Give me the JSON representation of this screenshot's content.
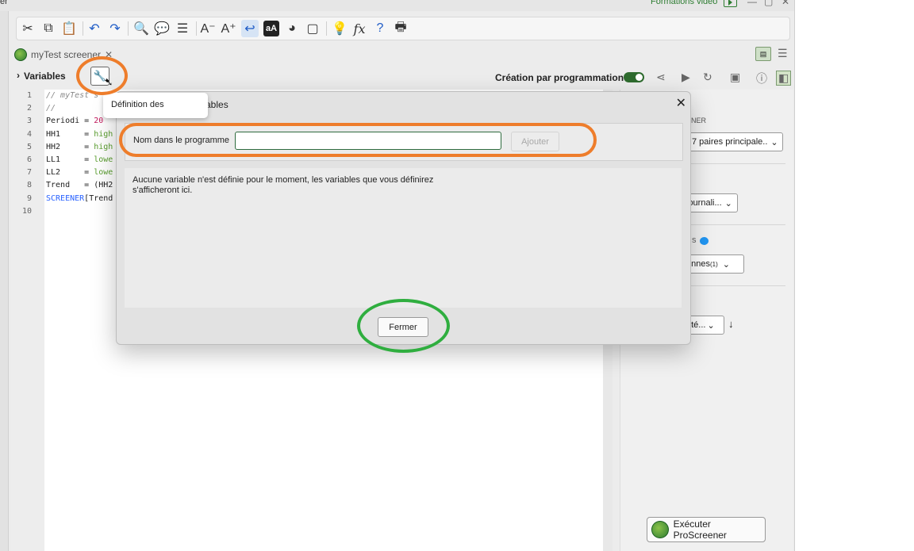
{
  "window": {
    "title_fragment": "er",
    "promo_link": "Formations vidéo"
  },
  "toolbar": {
    "icons": [
      "cut-icon",
      "copy-icon",
      "paste-icon",
      "undo-icon",
      "redo-icon",
      "search-icon",
      "comment-icon",
      "indent-icon",
      "decrease-font-icon",
      "increase-font-icon",
      "wrap-icon",
      "font-case-icon",
      "color-wheel-icon",
      "frame-icon",
      "bulb-icon",
      "function-icon",
      "help-icon",
      "print-icon"
    ]
  },
  "tab": {
    "label": "myTest screener",
    "close": "✕"
  },
  "varbar": {
    "label": "Variables",
    "creation_label": "Création par programmation"
  },
  "tooltip": {
    "text": "Définition des"
  },
  "editor": {
    "line_numbers": [
      "1",
      "2",
      "3",
      "4",
      "5",
      "6",
      "7",
      "8",
      "9",
      "10"
    ],
    "lines": [
      [
        {
          "t": "// myTest s",
          "c": "c-com"
        }
      ],
      [
        {
          "t": "//",
          "c": "c-com"
        }
      ],
      [
        {
          "t": "Periodi = ",
          "c": ""
        },
        {
          "t": "20",
          "c": "c-num"
        }
      ],
      [
        {
          "t": "HH1     = ",
          "c": ""
        },
        {
          "t": "high",
          "c": "c-grn"
        }
      ],
      [
        {
          "t": "HH2     = ",
          "c": ""
        },
        {
          "t": "high",
          "c": "c-grn"
        }
      ],
      [
        {
          "t": "LL1     = ",
          "c": ""
        },
        {
          "t": "lowe",
          "c": "c-grn"
        }
      ],
      [
        {
          "t": "LL2     = ",
          "c": ""
        },
        {
          "t": "lowe",
          "c": "c-grn"
        }
      ],
      [
        {
          "t": "Trend   = (HH2",
          "c": ""
        }
      ],
      [
        {
          "t": "SCREENER",
          "c": "c-blu"
        },
        {
          "t": "[Trend",
          "c": ""
        }
      ],
      []
    ]
  },
  "dialog": {
    "title_fragment": "ables",
    "close": "✕",
    "name_label": "Nom dans le programme",
    "name_value": "",
    "add_button": "Ajouter",
    "info_text": "Aucune variable n'est définie pour le moment, les variables que vous définirez s'afficheront ici.",
    "close_button": "Fermer"
  },
  "rightpanel": {
    "section1_fragment": "NER",
    "select1": "7 paires principale..",
    "select2": "journali...",
    "section3_fragment": "s",
    "select3_text": "onnes",
    "select3_sup": "(1)",
    "select4": "rité...",
    "run_button": "Exécuter ProScreener"
  },
  "colors": {
    "highlight_orange": "#ee7d2b",
    "highlight_green": "#2fae3f",
    "toggle_on": "#2e6b2e",
    "accent_green": "#2e7d32"
  }
}
